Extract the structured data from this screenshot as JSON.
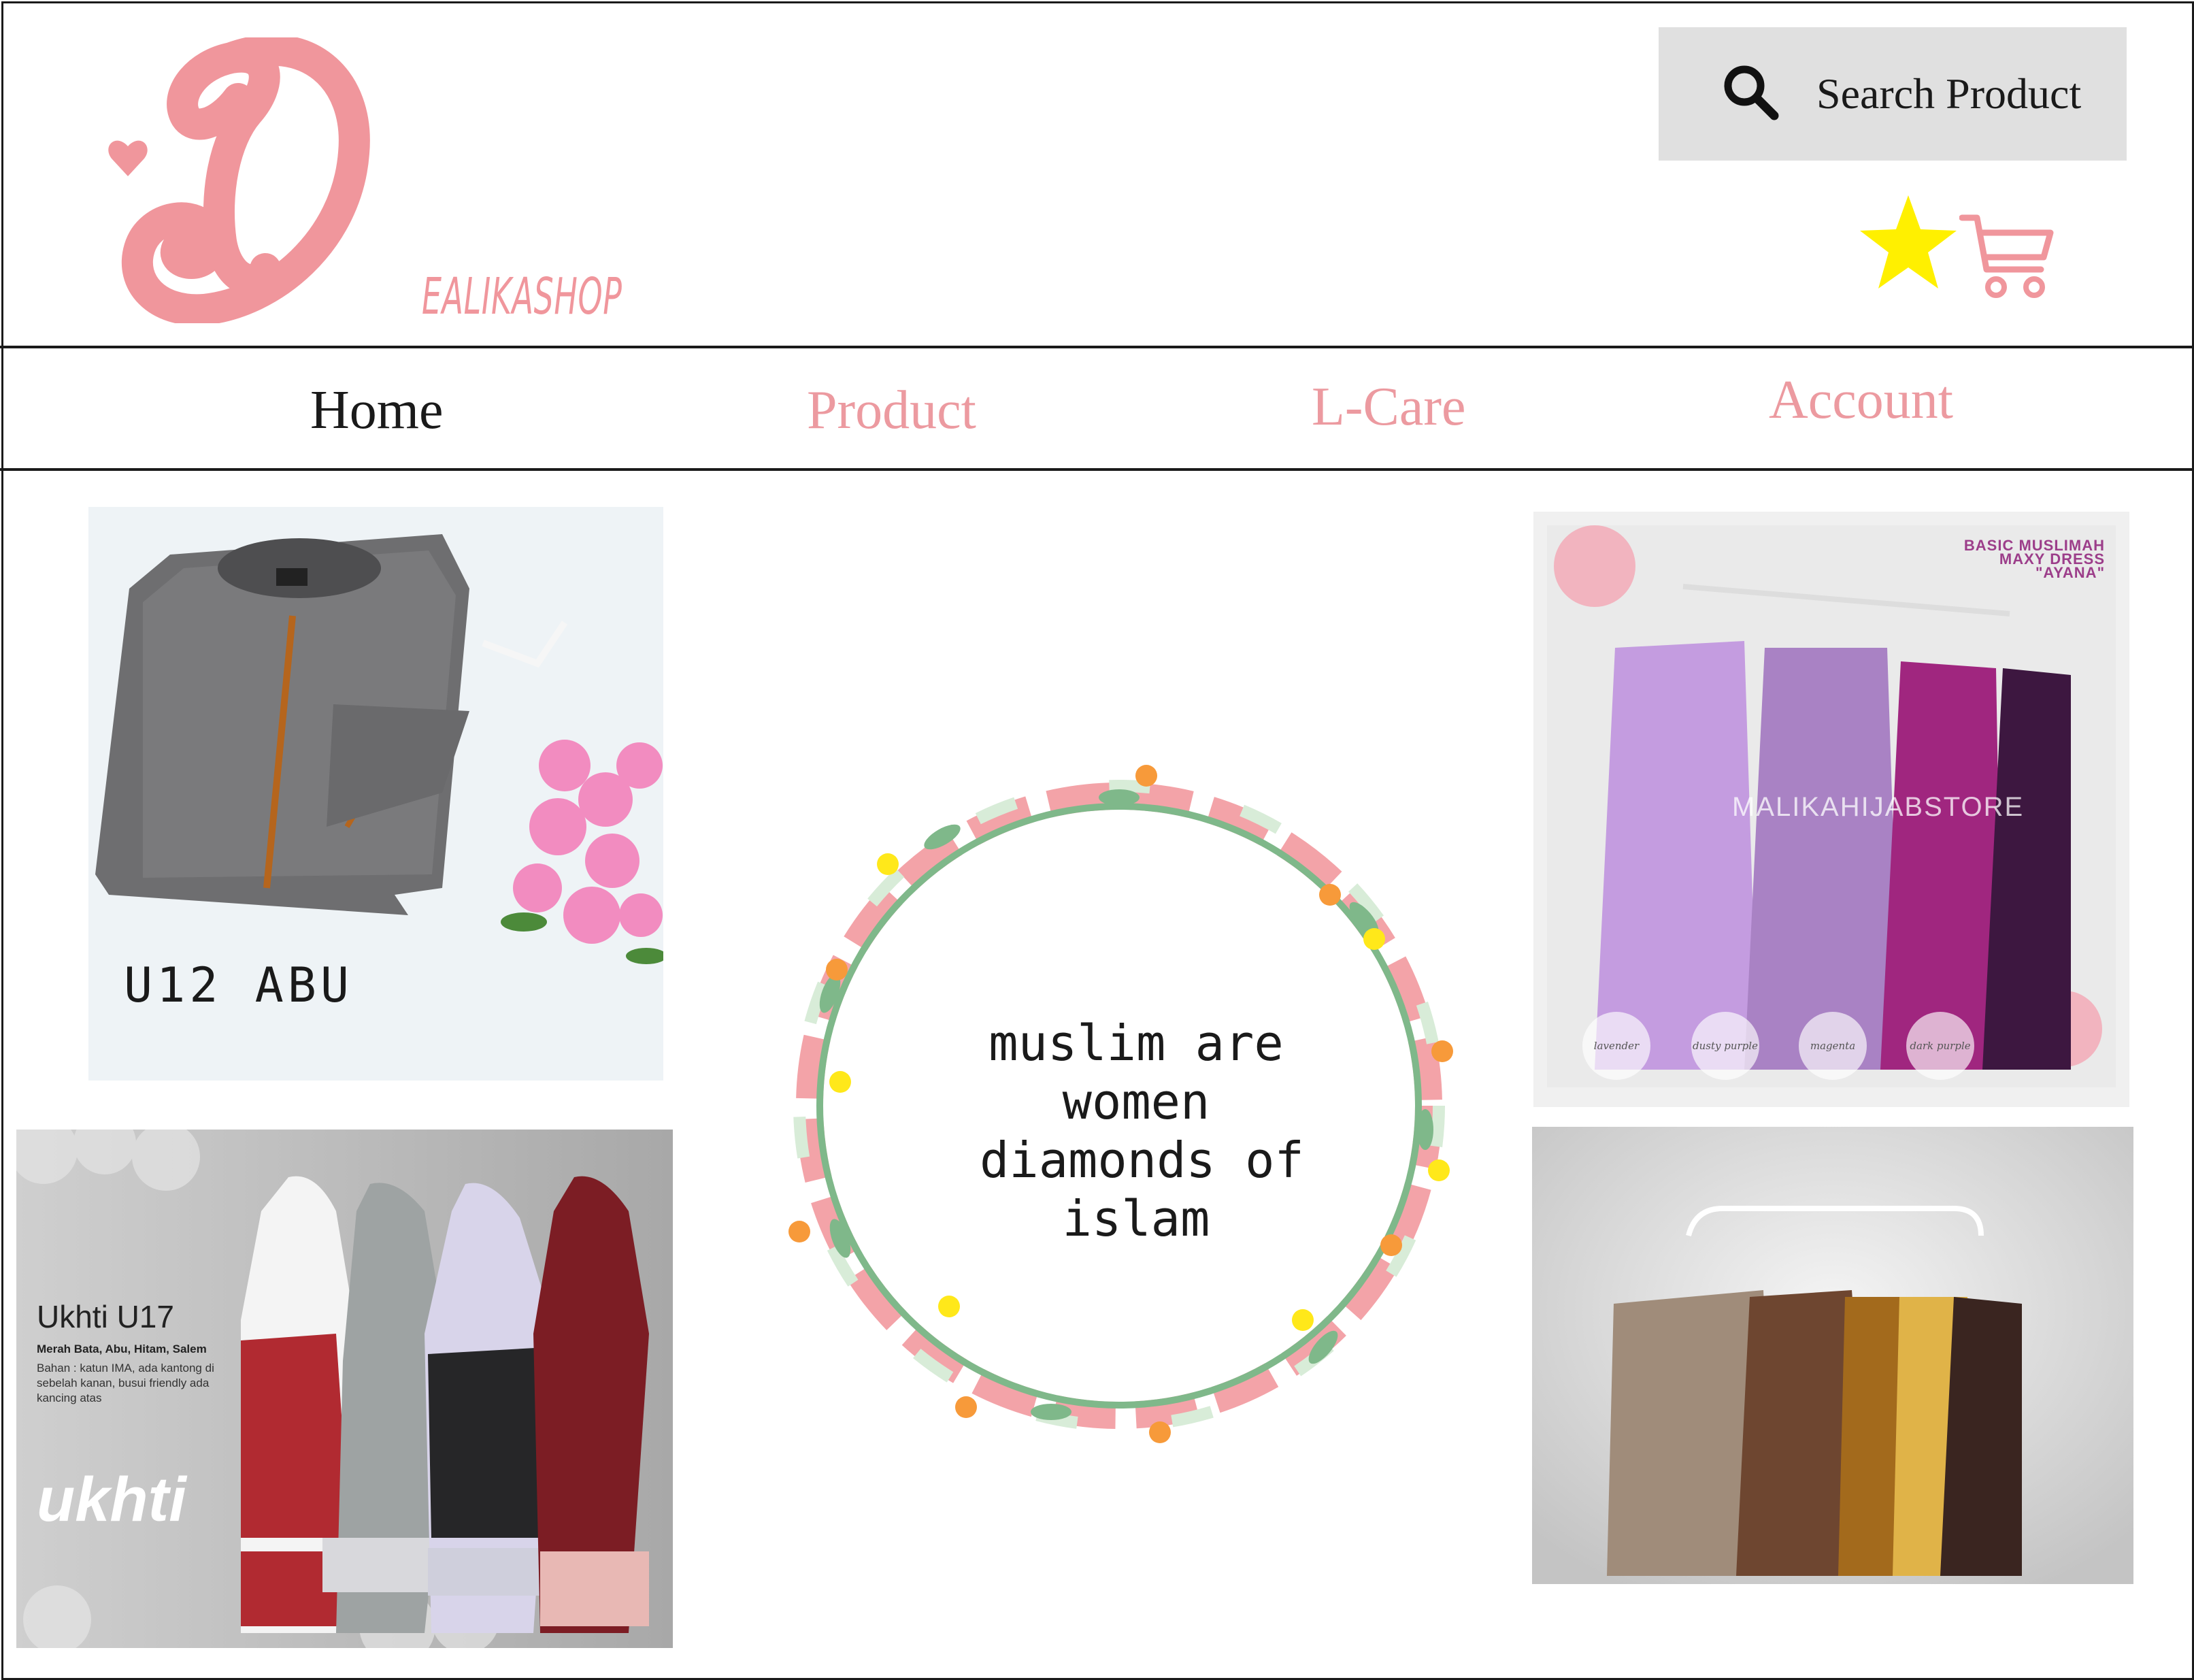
{
  "header": {
    "logo_letter": "D",
    "logo_text": "EALIKASHOP",
    "brand_color": "#f0969c",
    "search": {
      "label": "Search Product",
      "icon": "search-icon"
    },
    "icons": {
      "favorite": "star-icon",
      "cart": "cart-icon"
    },
    "star_color": "#fff000"
  },
  "nav": {
    "items": [
      {
        "label": "Home",
        "active": true
      },
      {
        "label": "Product",
        "active": false
      },
      {
        "label": "L-Care",
        "active": false
      },
      {
        "label": "Account",
        "active": false
      }
    ],
    "active_color": "#1a1a1a",
    "inactive_color": "#ec9aa0"
  },
  "products": {
    "u12": {
      "caption": "U12 ABU"
    },
    "u17": {
      "title": "Ukhti U17",
      "colors": "Merah Bata, Abu, Hitam, Salem",
      "description": "Bahan : katun IMA, ada kantong di sebelah kanan, busui friendly ada kancing atas",
      "brand": "ukhti"
    },
    "ayana": {
      "heading_line1": "BASIC MUSLIMAH",
      "heading_line2": "MAXY DRESS",
      "heading_line3": "\"AYANA\"",
      "watermark": "MALIKAHIJABSTORE",
      "swatches": [
        "lavender",
        "dusty purple",
        "magenta",
        "dark purple"
      ]
    },
    "earth": {}
  },
  "quote": {
    "lines": [
      "muslim are",
      "women",
      "diamonds of",
      "islam"
    ]
  }
}
